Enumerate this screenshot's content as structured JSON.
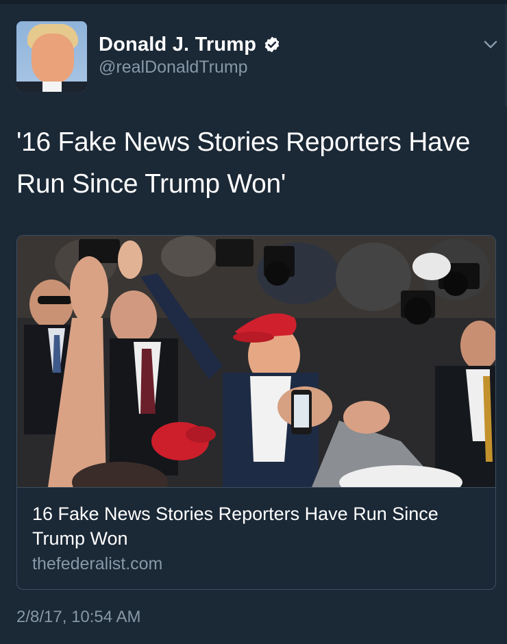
{
  "tweet": {
    "author": {
      "display_name": "Donald J. Trump",
      "handle": "@realDonaldTrump",
      "verified": true
    },
    "text_line1": "'16 Fake News Stories Reporters Have",
    "text_line2": "Run Since Trump Won'",
    "card": {
      "title": "16 Fake News Stories Reporters Have Run Since Trump Won",
      "domain": "thefederalist.com",
      "photo": "crowd-of-photographers-red-hat-photo"
    },
    "timestamp": "2/8/17, 10:54 AM"
  },
  "icons": {
    "verified": "verified-badge-icon",
    "menu": "chevron-down-icon"
  },
  "colors": {
    "background": "#1b2836",
    "secondary_text": "#8899a6",
    "card_border": "#3d4f61",
    "hat_red": "#d0202e"
  }
}
